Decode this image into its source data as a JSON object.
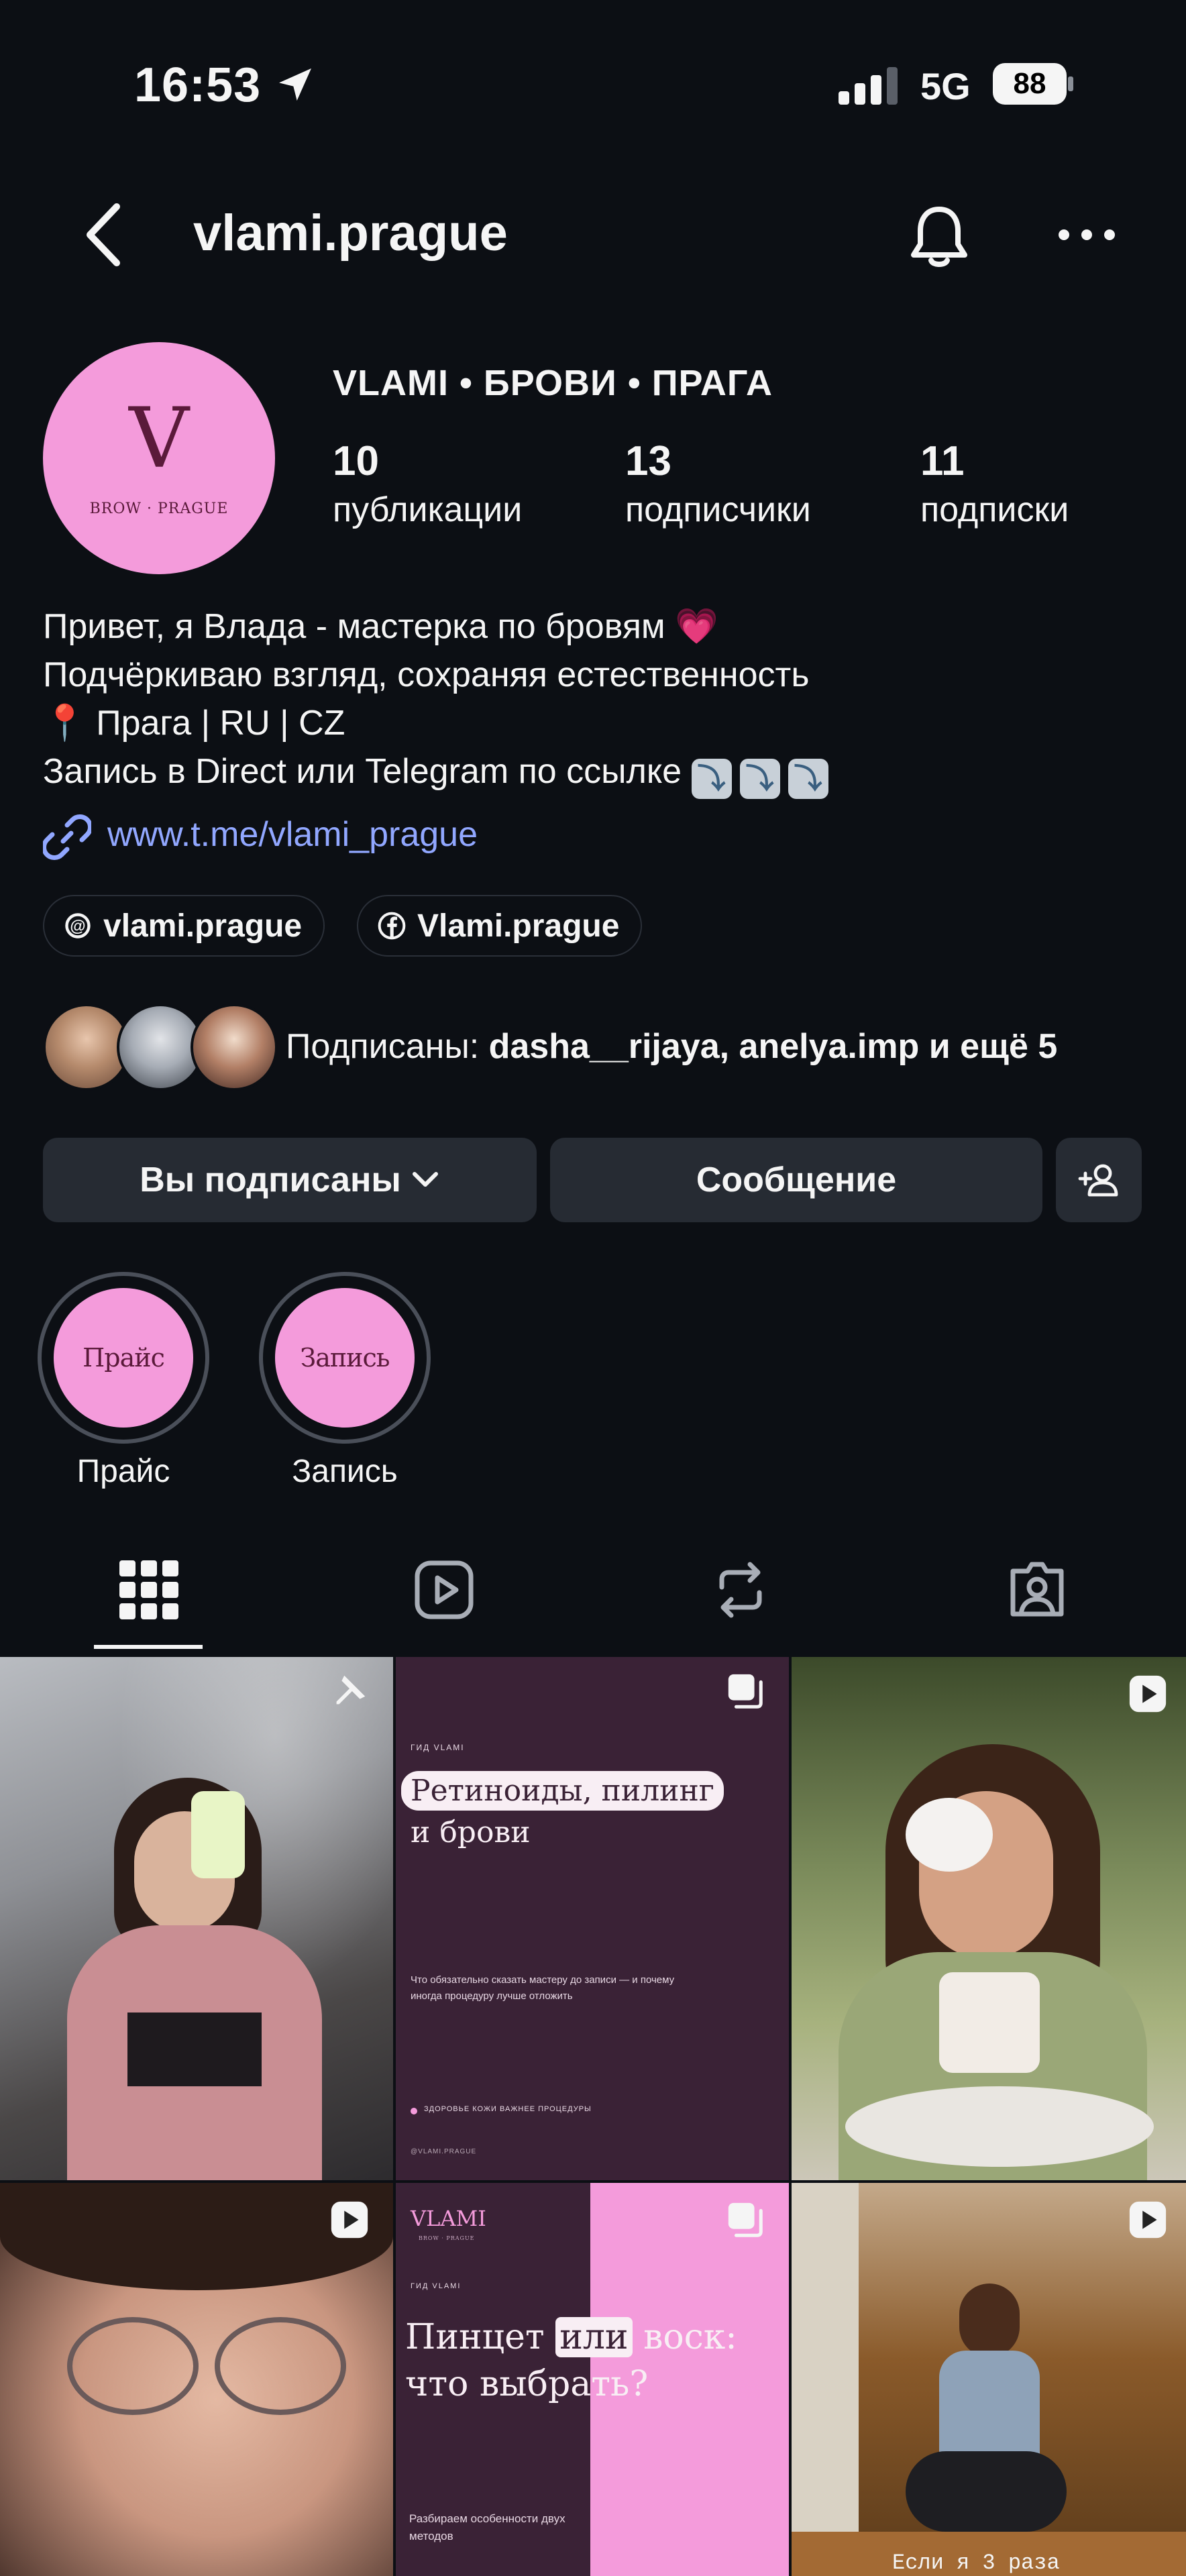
{
  "status_bar": {
    "time": "16:53",
    "network": "5G",
    "battery": "88"
  },
  "header": {
    "username": "vlami.prague"
  },
  "profile": {
    "avatar_letter": "V",
    "avatar_subtitle": "BROW · PRAGUE",
    "display_name": "VLAMI • БРОВИ • ПРАГА",
    "stats": [
      {
        "value": "10",
        "label": "публикации"
      },
      {
        "value": "13",
        "label": "подписчики"
      },
      {
        "value": "11",
        "label": "подписки"
      }
    ],
    "bio": {
      "line1": "Привет, я Влада - мастерка по бровям 💗",
      "line2": "Подчёркиваю взгляд, сохраняя естественность",
      "line3": "📍 Прага | RU | CZ",
      "line4": "Запись в Direct или Telegram по ссылке"
    },
    "link": "www.t.me/vlami_prague",
    "chips": [
      {
        "label": "vlami.prague",
        "icon": "threads-icon"
      },
      {
        "label": "Vlami.prague",
        "icon": "facebook-icon"
      }
    ],
    "mutual": {
      "prefix": "Подписаны: ",
      "names": "dasha__rijaya, anelya.imp",
      "suffix": " и ещё 5"
    }
  },
  "actions": {
    "following": "Вы подписаны",
    "message": "Сообщение"
  },
  "highlights": [
    {
      "cover_text": "Прайс",
      "label": "Прайс"
    },
    {
      "cover_text": "Запись",
      "label": "Запись"
    }
  ],
  "tabs": [
    "grid-icon",
    "reels-icon",
    "reposts-icon",
    "tagged-icon"
  ],
  "grid": {
    "post2": {
      "kicker": "ГИД VLAMI",
      "title_line1": "Ретиноиды, пилинг",
      "title_line2": "и брови",
      "body": "Что обязательно сказать мастеру до записи — и почему иногда процедуру лучше отложить",
      "footer": "ЗДОРОВЬЕ КОЖИ ВАЖНЕЕ ПРОЦЕДУРЫ",
      "handle": "@VLAMI.PRAGUE"
    },
    "post5": {
      "brand": "VLAMI",
      "brand_sub": "BROW · PRAGUE",
      "kicker": "ГИД VLAMI",
      "title_part1": "Пинцет ",
      "title_highlight": "или",
      "title_part2": " воск:",
      "title_line2": "что выбрать?",
      "body": "Разбираем особенности двух методов"
    },
    "post6": {
      "caption": "Если я 3 раза"
    }
  },
  "colors": {
    "accent_pink": "#f49bdb",
    "link_blue": "#91a7ff",
    "background": "#0c0f14",
    "button": "#262b33"
  }
}
